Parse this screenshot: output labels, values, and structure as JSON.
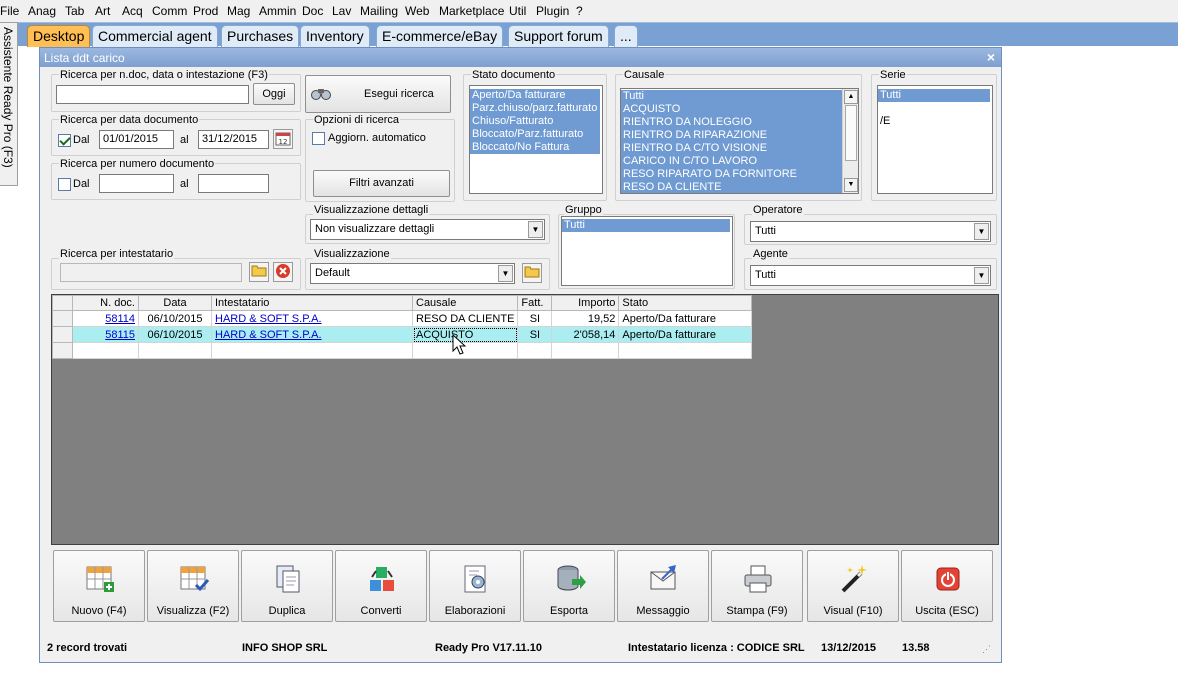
{
  "menubar": {
    "items": [
      "File",
      "Anag",
      "Tab",
      "Art",
      "Acq",
      "Comm",
      "Prod",
      "Mag",
      "Ammin",
      "Doc",
      "Lav",
      "Mailing",
      "Web",
      "Marketplace",
      "Util",
      "Plugin",
      "?"
    ]
  },
  "tabs": [
    "Desktop",
    "Commercial agent",
    "Purchases",
    "Inventory",
    "E-commerce/eBay",
    "Support forum",
    "..."
  ],
  "side_tab": "Assistente Ready Pro (F3)",
  "window": {
    "title": "Lista ddt carico",
    "close": "×"
  },
  "search_text": {
    "legend": "Ricerca per n.doc, data o intestazione (F3)",
    "value": "",
    "button": "Oggi"
  },
  "search_date": {
    "legend": "Ricerca per data documento",
    "checkbox_label": "Dal",
    "from": "01/01/2015",
    "to_label": "al",
    "to": "31/12/2015"
  },
  "search_number": {
    "legend": "Ricerca per numero documento",
    "checkbox_label": "Dal",
    "from": "",
    "to_label": "al",
    "to": ""
  },
  "execute_search": "Esegui ricerca",
  "search_options": {
    "legend": "Opzioni di ricerca",
    "auto_update": "Aggiorn. automatico",
    "advanced": "Filtri avanzati"
  },
  "stato_documento": {
    "legend": "Stato documento",
    "items": [
      "Aperto/Da fatturare",
      "Parz.chiuso/parz.fatturato",
      "Chiuso/Fatturato",
      "Bloccato/Parz.fatturato",
      "Bloccato/No Fattura"
    ]
  },
  "causale": {
    "legend": "Causale",
    "items": [
      "Tutti",
      "ACQUISTO",
      "RIENTRO DA NOLEGGIO",
      "RIENTRO DA RIPARAZIONE",
      "RIENTRO DA C/TO VISIONE",
      "CARICO IN C/TO LAVORO",
      "RESO RIPARATO DA FORNITORE",
      "RESO DA CLIENTE"
    ]
  },
  "serie": {
    "legend": "Serie",
    "items": [
      "Tutti",
      "",
      "/E"
    ]
  },
  "dettagli": {
    "legend": "Visualizzazione dettagli",
    "value": "Non visualizzare dettagli"
  },
  "gruppo": {
    "legend": "Gruppo",
    "items": [
      "Tutti"
    ]
  },
  "operatore": {
    "legend": "Operatore",
    "value": "Tutti"
  },
  "intestatario": {
    "legend": "Ricerca per intestatario",
    "value": ""
  },
  "visualizzazione": {
    "legend": "Visualizzazione",
    "value": "Default"
  },
  "agente": {
    "legend": "Agente",
    "value": "Tutti"
  },
  "grid": {
    "columns": [
      "N. doc.",
      "Data",
      "Intestatario",
      "Causale",
      "Fatt.",
      "Importo",
      "Stato"
    ],
    "rows": [
      {
        "ndoc": "58114",
        "data": "06/10/2015",
        "intestatario": "HARD & SOFT S.P.A.",
        "causale": "RESO DA CLIENTE",
        "fatt": "SI",
        "importo": "19,52",
        "stato": "Aperto/Da fatturare"
      },
      {
        "ndoc": "58115",
        "data": "06/10/2015",
        "intestatario": "HARD & SOFT S.P.A.",
        "causale": "ACQUISTO",
        "fatt": "SI",
        "importo": "2'058,14",
        "stato": "Aperto/Da fatturare"
      }
    ]
  },
  "toolbar": [
    {
      "label": "Nuovo (F4)",
      "icon": "new-grid-icon"
    },
    {
      "label": "Visualizza (F2)",
      "icon": "view-grid-icon"
    },
    {
      "label": "Duplica",
      "icon": "duplicate-icon"
    },
    {
      "label": "Converti",
      "icon": "convert-icon"
    },
    {
      "label": "Elaborazioni",
      "icon": "process-icon"
    },
    {
      "label": "Esporta",
      "icon": "export-icon"
    },
    {
      "label": "Messaggio",
      "icon": "message-icon"
    },
    {
      "label": "Stampa (F9)",
      "icon": "print-icon"
    },
    {
      "label": "Visual (F10)",
      "icon": "magic-wand-icon"
    },
    {
      "label": "Uscita (ESC)",
      "icon": "exit-icon"
    }
  ],
  "status": {
    "records": "2 record trovati",
    "company": "INFO SHOP SRL",
    "version": "Ready Pro V17.11.10",
    "license": "Intestatario licenza : CODICE SRL",
    "date": "13/12/2015",
    "time": "13.58"
  }
}
